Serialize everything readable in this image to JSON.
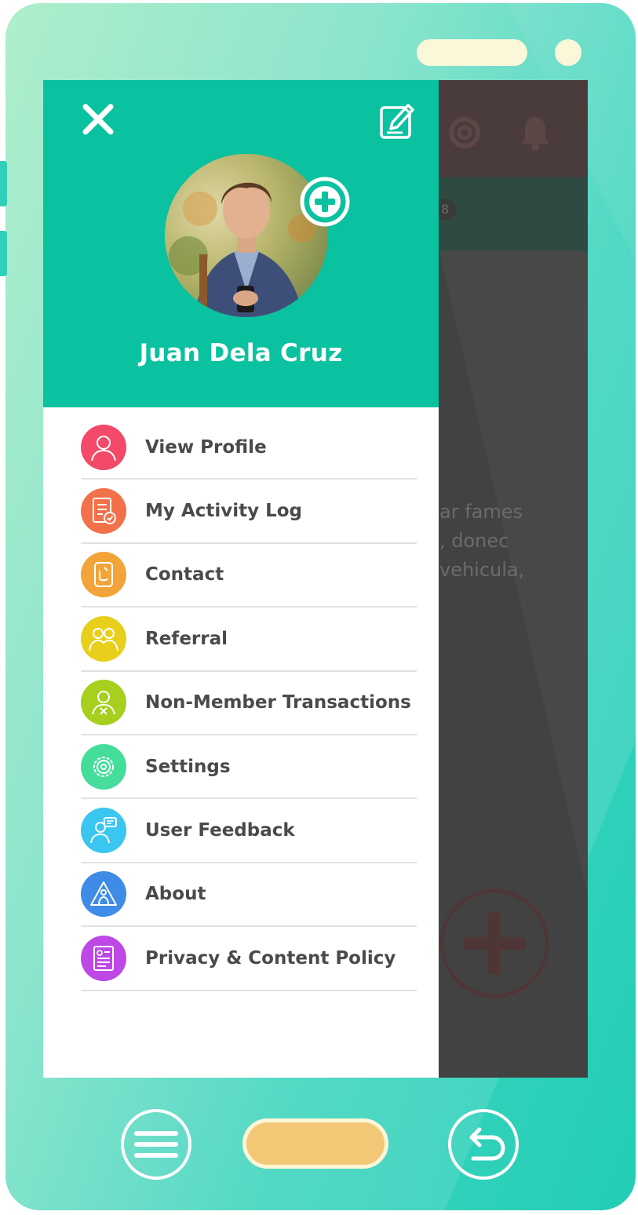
{
  "profile": {
    "name": "Juan Dela Cruz",
    "photo_alt": "Profile photo"
  },
  "header": {
    "close_icon": "close-icon",
    "edit_icon": "edit-icon",
    "add_photo_icon": "add-photo-icon"
  },
  "menu": {
    "items": [
      {
        "label": "View Profile",
        "icon": "user-icon",
        "color": "#f24a68"
      },
      {
        "label": "My Activity Log",
        "icon": "activity-log-icon",
        "color": "#f2704a"
      },
      {
        "label": "Contact",
        "icon": "contact-icon",
        "color": "#f2a43a"
      },
      {
        "label": "Referral",
        "icon": "referral-icon",
        "color": "#e8cf1c"
      },
      {
        "label": "Non-Member Transactions",
        "icon": "non-member-icon",
        "color": "#a6cf1e"
      },
      {
        "label": "Settings",
        "icon": "gear-icon",
        "color": "#45dd9a"
      },
      {
        "label": "User Feedback",
        "icon": "feedback-icon",
        "color": "#3ac6f0"
      },
      {
        "label": "About",
        "icon": "about-icon",
        "color": "#3f8be8"
      },
      {
        "label": "Privacy & Content Policy",
        "icon": "policy-icon",
        "color": "#bd48e6"
      }
    ]
  },
  "background": {
    "tab_count": "8",
    "text_lines": [
      "ar fames",
      ", donec",
      "vehicula,"
    ]
  },
  "colors": {
    "accent": "#0ac1a0",
    "phone_body": "#22cdb6",
    "home_button": "#f2c877"
  }
}
